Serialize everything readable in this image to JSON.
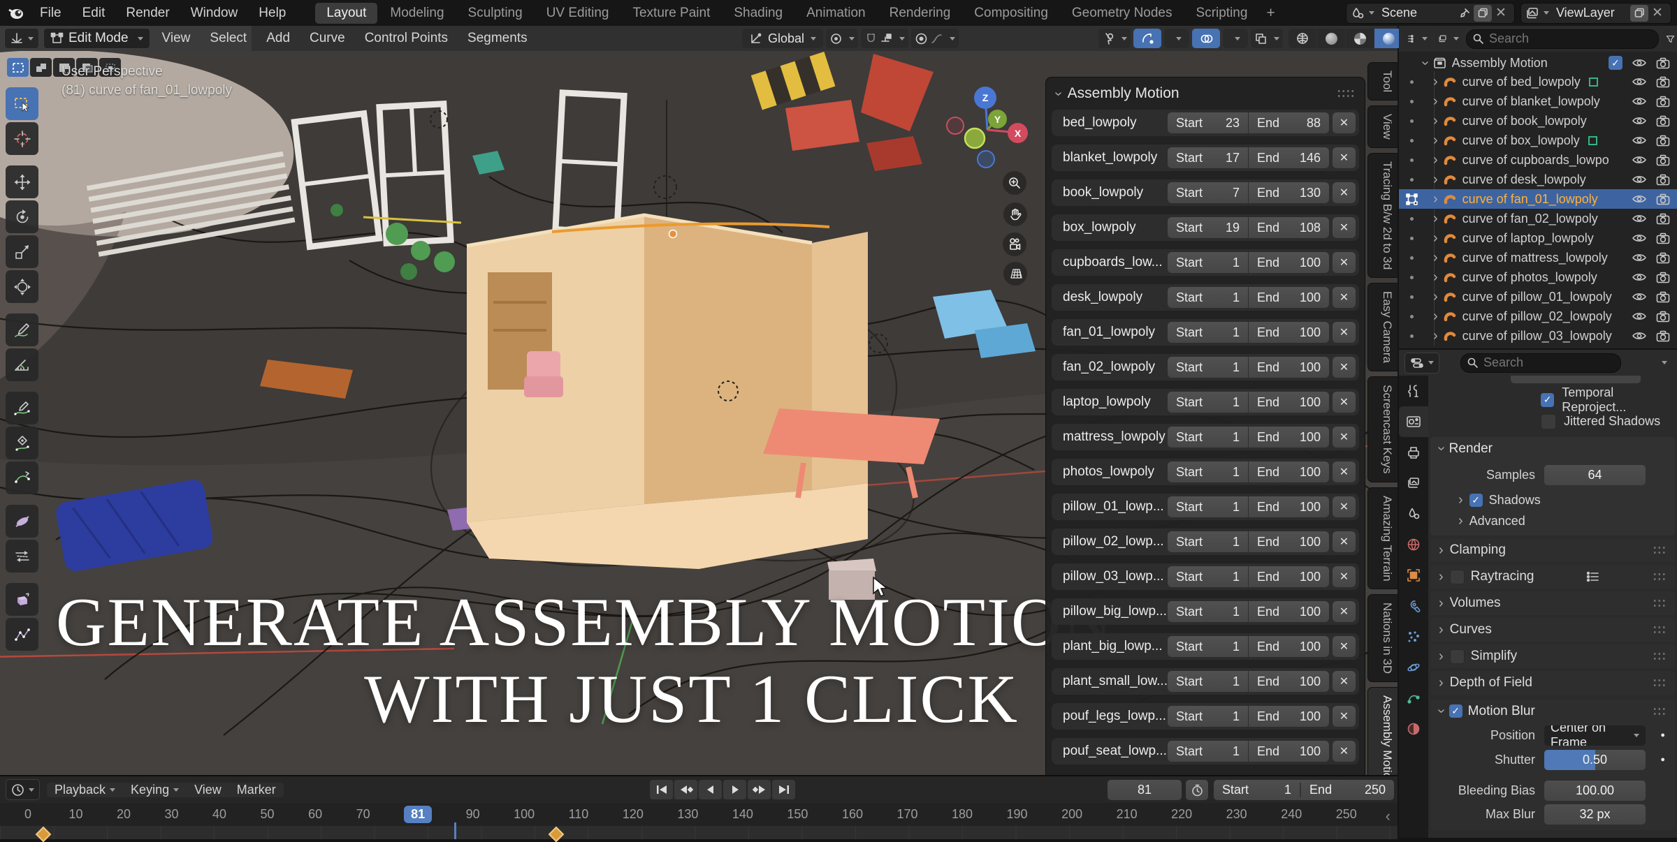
{
  "icons": {
    "close": "✕",
    "check": "✓",
    "expander": "›",
    "record_circle": "○",
    "anim_dot": "●",
    "resize_arrow": "‹"
  },
  "topbar": {
    "app_menus": [
      "File",
      "Edit",
      "Render",
      "Window",
      "Help"
    ],
    "workspaces": [
      {
        "label": "Layout",
        "active": true
      },
      {
        "label": "Modeling"
      },
      {
        "label": "Sculpting"
      },
      {
        "label": "UV Editing"
      },
      {
        "label": "Texture Paint"
      },
      {
        "label": "Shading"
      },
      {
        "label": "Animation"
      },
      {
        "label": "Rendering"
      },
      {
        "label": "Compositing"
      },
      {
        "label": "Geometry Nodes"
      },
      {
        "label": "Scripting"
      }
    ],
    "add_workspace": "+",
    "scene_name": "Scene",
    "view_layer_name": "ViewLayer"
  },
  "viewport_header": {
    "mode_label": "Edit Mode",
    "menus": [
      "View",
      "Select",
      "Add",
      "Curve",
      "Control Points",
      "Segments"
    ],
    "orientation_label": "Global"
  },
  "viewport": {
    "view_label": "User Perspective",
    "active_object": "(81) curve of fan_01_lowpoly",
    "axis_z": "Z",
    "axis_y": "Y",
    "axis_x": "X",
    "headline_line1": "GENERATE ASSEMBLY MOTION",
    "headline_line2": "WITH JUST 1 CLICK",
    "toolbar_tools": [
      "select-box",
      "cursor",
      "move",
      "rotate",
      "scale",
      "transform",
      "annotate",
      "measure",
      "draw-curve",
      "curve-pen",
      "pen",
      "tilt",
      "shear",
      "extrude",
      "randomize"
    ],
    "side_tabs": [
      {
        "label": "Tool"
      },
      {
        "label": "View"
      },
      {
        "label": "Tracing B/w 2d to 3d"
      },
      {
        "label": "Easy Camera"
      },
      {
        "label": "Screencast Keys"
      },
      {
        "label": "Amazing Terrain"
      },
      {
        "label": "Nations in 3D"
      },
      {
        "label": "Assembly Motion",
        "active": true
      }
    ]
  },
  "assembly_panel": {
    "title": "Assembly Motion",
    "start_label": "Start",
    "end_label": "End",
    "rows": [
      {
        "name": "bed_lowpoly",
        "start": "23",
        "end": "88"
      },
      {
        "name": "blanket_lowpoly",
        "start": "17",
        "end": "146"
      },
      {
        "name": "book_lowpoly",
        "start": "7",
        "end": "130"
      },
      {
        "name": "box_lowpoly",
        "start": "19",
        "end": "108"
      },
      {
        "name": "cupboards_low...",
        "start": "1",
        "end": "100"
      },
      {
        "name": "desk_lowpoly",
        "start": "1",
        "end": "100"
      },
      {
        "name": "fan_01_lowpoly",
        "start": "1",
        "end": "100"
      },
      {
        "name": "fan_02_lowpoly",
        "start": "1",
        "end": "100"
      },
      {
        "name": "laptop_lowpoly",
        "start": "1",
        "end": "100"
      },
      {
        "name": "mattress_lowpoly",
        "start": "1",
        "end": "100"
      },
      {
        "name": "photos_lowpoly",
        "start": "1",
        "end": "100"
      },
      {
        "name": "pillow_01_lowp...",
        "start": "1",
        "end": "100"
      },
      {
        "name": "pillow_02_lowp...",
        "start": "1",
        "end": "100"
      },
      {
        "name": "pillow_03_lowp...",
        "start": "1",
        "end": "100"
      },
      {
        "name": "pillow_big_lowp...",
        "start": "1",
        "end": "100"
      },
      {
        "name": "plant_big_lowp...",
        "start": "1",
        "end": "100"
      },
      {
        "name": "plant_small_low...",
        "start": "1",
        "end": "100"
      },
      {
        "name": "pouf_legs_lowp...",
        "start": "1",
        "end": "100"
      },
      {
        "name": "pouf_seat_lowp...",
        "start": "1",
        "end": "100"
      }
    ]
  },
  "outliner": {
    "search_placeholder": "Search",
    "collection_label": "Assembly Motion",
    "items": [
      {
        "label": "curve of bed_lowpoly",
        "badge": true
      },
      {
        "label": "curve of blanket_lowpoly"
      },
      {
        "label": "curve of book_lowpoly"
      },
      {
        "label": "curve of box_lowpoly",
        "badge": true
      },
      {
        "label": "curve of cupboards_lowpo"
      },
      {
        "label": "curve of desk_lowpoly"
      },
      {
        "label": "curve of fan_01_lowpoly",
        "active": true
      },
      {
        "label": "curve of fan_02_lowpoly"
      },
      {
        "label": "curve of laptop_lowpoly"
      },
      {
        "label": "curve of mattress_lowpoly"
      },
      {
        "label": "curve of photos_lowpoly"
      },
      {
        "label": "curve of pillow_01_lowpoly"
      },
      {
        "label": "curve of pillow_02_lowpoly"
      },
      {
        "label": "curve of pillow_03_lowpoly"
      }
    ]
  },
  "properties": {
    "search_placeholder": "Search",
    "temporal_label": "Temporal Reproject...",
    "jittered_label": "Jittered Shadows",
    "render_title": "Render",
    "samples_label": "Samples",
    "samples_value": "64",
    "shadows_label": "Shadows",
    "advanced_label": "Advanced",
    "panels": [
      {
        "label": "Clamping"
      },
      {
        "label": "Raytracing",
        "checkbox": true,
        "list_icon": true
      },
      {
        "label": "Volumes"
      },
      {
        "label": "Curves"
      },
      {
        "label": "Simplify",
        "checkbox": true
      },
      {
        "label": "Depth of Field"
      }
    ],
    "motion_blur_title": "Motion Blur",
    "position_label": "Position",
    "position_value": "Center on Frame",
    "shutter_label": "Shutter",
    "shutter_value": "0.50",
    "bleeding_label": "Bleeding Bias",
    "bleeding_value": "100.00",
    "max_blur_label": "Max Blur",
    "max_blur_value": "32 px"
  },
  "timeline": {
    "menus": [
      {
        "label": "Playback",
        "dropdown": true
      },
      {
        "label": "Keying",
        "dropdown": true
      },
      {
        "label": "View"
      },
      {
        "label": "Marker"
      }
    ],
    "frame_field_value": "81",
    "start_label": "Start",
    "start_value": "1",
    "end_label": "End",
    "end_value": "250",
    "ticks": [
      {
        "label": "0"
      },
      {
        "label": "10"
      },
      {
        "label": "20"
      },
      {
        "label": "30"
      },
      {
        "label": "40"
      },
      {
        "label": "50"
      },
      {
        "label": "60"
      },
      {
        "label": "70"
      },
      {
        "label": "81",
        "active": true
      },
      {
        "label": "90"
      },
      {
        "label": "100"
      },
      {
        "label": "110"
      },
      {
        "label": "120"
      },
      {
        "label": "130"
      },
      {
        "label": "140"
      },
      {
        "label": "150"
      },
      {
        "label": "160"
      },
      {
        "label": "170"
      },
      {
        "label": "180"
      },
      {
        "label": "190"
      },
      {
        "label": "200"
      },
      {
        "label": "210"
      },
      {
        "label": "220"
      },
      {
        "label": "230"
      },
      {
        "label": "240"
      },
      {
        "label": "250"
      }
    ]
  }
}
